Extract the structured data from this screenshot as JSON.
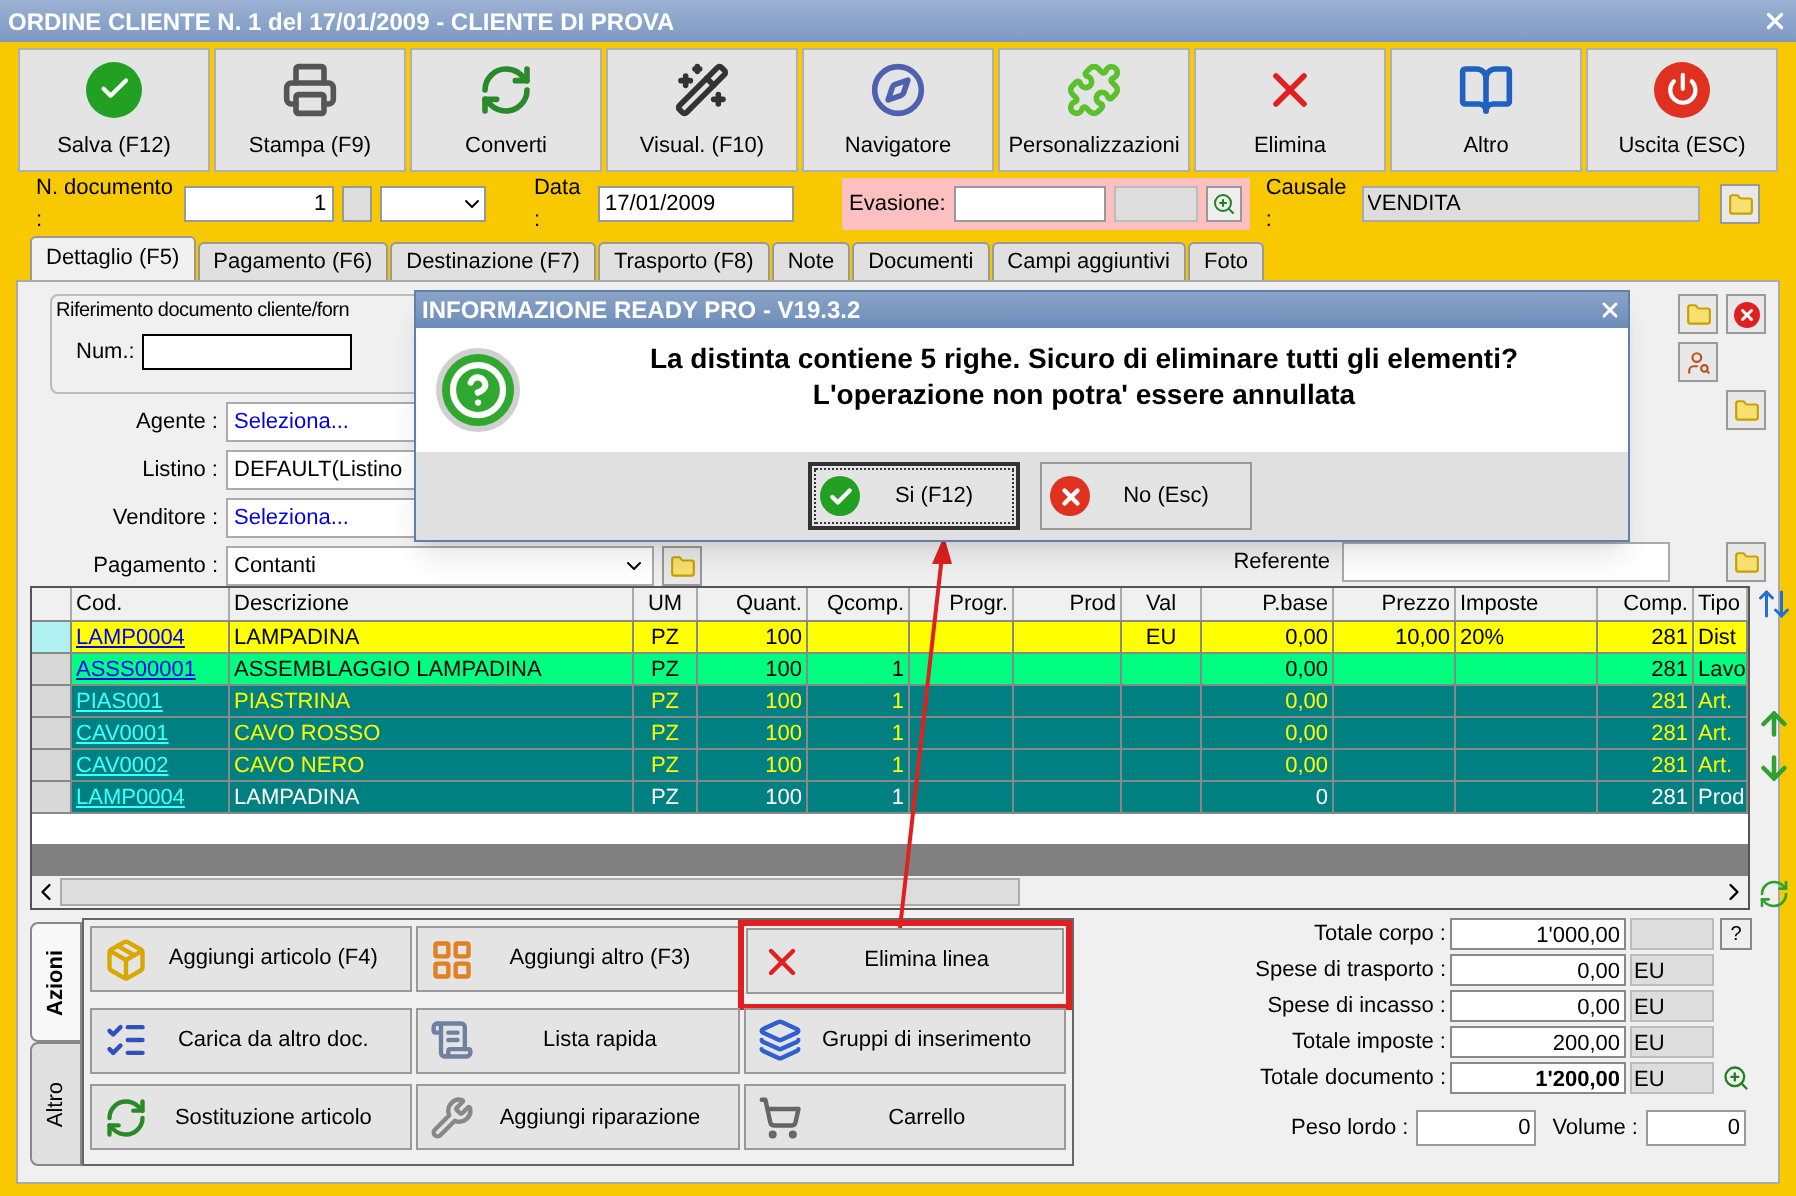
{
  "window": {
    "title": "ORDINE CLIENTE N. 1 del 17/01/2009 - CLIENTE DI PROVA"
  },
  "toolbar": [
    {
      "label": "Salva (F12)",
      "kind": "check"
    },
    {
      "label": "Stampa (F9)",
      "kind": "printer"
    },
    {
      "label": "Converti",
      "kind": "convert"
    },
    {
      "label": "Visual. (F10)",
      "kind": "wand"
    },
    {
      "label": "Navigatore",
      "kind": "compass"
    },
    {
      "label": "Personalizzazioni",
      "kind": "puzzle"
    },
    {
      "label": "Elimina",
      "kind": "delete"
    },
    {
      "label": "Altro",
      "kind": "book"
    },
    {
      "label": "Uscita (ESC)",
      "kind": "power"
    }
  ],
  "header": {
    "doc_number_label": "N. documento :",
    "doc_number": "1",
    "date_label": "Data :",
    "date": "17/01/2009",
    "evasione_label": "Evasione:",
    "causale_label": "Causale :",
    "causale": "VENDITA"
  },
  "tabs": [
    {
      "label": "Dettaglio (F5)",
      "selected": true
    },
    {
      "label": "Pagamento (F6)",
      "selected": false
    },
    {
      "label": "Destinazione (F7)",
      "selected": false
    },
    {
      "label": "Trasporto (F8)",
      "selected": false
    },
    {
      "label": "Note",
      "selected": false
    },
    {
      "label": "Documenti",
      "selected": false
    },
    {
      "label": "Campi aggiuntivi",
      "selected": false
    },
    {
      "label": "Foto",
      "selected": false
    }
  ],
  "form": {
    "reference_group": "Riferimento documento cliente/forn",
    "num_label": "Num.:",
    "fields": [
      {
        "label": "Agente :",
        "value": "Seleziona...",
        "kind": "link"
      },
      {
        "label": "Listino :",
        "value": "DEFAULT(Listino",
        "kind": "text"
      },
      {
        "label": "Venditore :",
        "value": "Seleziona...",
        "kind": "link"
      },
      {
        "label": "Pagamento :",
        "value": "Contanti",
        "kind": "dropdown"
      }
    ],
    "referente_label": "Referente"
  },
  "table": {
    "columns": [
      "Cod.",
      "Descrizione",
      "UM",
      "Quant.",
      "Qcomp.",
      "Progr.",
      "Prod",
      "Val",
      "P.base",
      "Prezzo",
      "Imposte",
      "Comp.",
      "Tipo"
    ],
    "rows": [
      {
        "cells": [
          "LAMP0004",
          "LAMPADINA",
          "PZ",
          "100",
          "",
          "",
          "",
          "EU",
          "0,00",
          "10,00",
          "20%",
          "281",
          "Dist"
        ],
        "color": "#ffff00",
        "kind": "header",
        "selected": true
      },
      {
        "cells": [
          "ASSS00001",
          "ASSEMBLAGGIO LAMPADINA",
          "PZ",
          "100",
          "1",
          "",
          "",
          "",
          "0,00",
          "",
          "",
          "281",
          "Lavo"
        ],
        "color": "#00ff80",
        "kind": "process",
        "selected": false
      },
      {
        "cells": [
          "PIAS001",
          "PIASTRINA",
          "PZ",
          "100",
          "1",
          "",
          "",
          "",
          "0,00",
          "",
          "",
          "281",
          "Art."
        ],
        "color": "#008080",
        "kind": "part",
        "selected": false
      },
      {
        "cells": [
          "CAV0001",
          "CAVO ROSSO",
          "PZ",
          "100",
          "1",
          "",
          "",
          "",
          "0,00",
          "",
          "",
          "281",
          "Art."
        ],
        "color": "#008080",
        "kind": "part",
        "selected": false
      },
      {
        "cells": [
          "CAV0002",
          "CAVO NERO",
          "PZ",
          "100",
          "1",
          "",
          "",
          "",
          "0,00",
          "",
          "",
          "281",
          "Art."
        ],
        "color": "#008080",
        "kind": "part",
        "selected": false
      },
      {
        "cells": [
          "LAMP0004",
          "LAMPADINA",
          "PZ",
          "100",
          "1",
          "",
          "",
          "",
          "0",
          "",
          "",
          "281",
          "Prod"
        ],
        "color": "#008080",
        "kind": "product",
        "selected": false
      }
    ]
  },
  "actions": {
    "tabs": [
      {
        "label": "Azioni",
        "selected": true
      },
      {
        "label": "Altro",
        "selected": false
      }
    ],
    "buttons": [
      {
        "label": "Aggiungi articolo (F4)",
        "kind": "box",
        "highlighted": false
      },
      {
        "label": "Aggiungi altro (F3)",
        "kind": "grid",
        "highlighted": false
      },
      {
        "label": "Elimina linea",
        "kind": "delete",
        "highlighted": true
      },
      {
        "label": "Carica da altro doc.",
        "kind": "checklist",
        "highlighted": false
      },
      {
        "label": "Lista rapida",
        "kind": "scroll",
        "highlighted": false
      },
      {
        "label": "Gruppi di inserimento",
        "kind": "group",
        "highlighted": false
      },
      {
        "label": "Sostituzione articolo",
        "kind": "convert",
        "highlighted": false
      },
      {
        "label": "Aggiungi riparazione",
        "kind": "wrench",
        "highlighted": false
      },
      {
        "label": "Carrello",
        "kind": "cart",
        "highlighted": false
      }
    ]
  },
  "totals": [
    {
      "label": "Totale corpo :",
      "value": "1'000,00",
      "bold": false,
      "kind": "help"
    },
    {
      "label": "Spese di trasporto :",
      "value": "0,00",
      "unit": "EU",
      "bold": false,
      "kind": "plain"
    },
    {
      "label": "Spese di incasso :",
      "value": "0,00",
      "unit": "EU",
      "bold": false,
      "kind": "plain"
    },
    {
      "label": "Totale imposte :",
      "value": "200,00",
      "unit": "EU",
      "bold": false,
      "kind": "plain"
    },
    {
      "label": "Totale documento :",
      "value": "1'200,00",
      "unit": "EU",
      "bold": true,
      "kind": "zoom"
    }
  ],
  "help_button": "?",
  "weight": {
    "peso_label": "Peso lordo :",
    "peso": "0",
    "volume_label": "Volume :",
    "volume": "0"
  },
  "dialog": {
    "title": "INFORMAZIONE READY PRO - V19.3.2",
    "message": [
      "La distinta contiene 5 righe. Sicuro di eliminare tutti gli elementi?",
      "L'operazione non potra' essere annullata"
    ],
    "buttons": [
      {
        "label": "Si (F12)",
        "kind": "yes",
        "focused": true
      },
      {
        "label": "No (Esc)",
        "kind": "no",
        "focused": false
      }
    ]
  }
}
